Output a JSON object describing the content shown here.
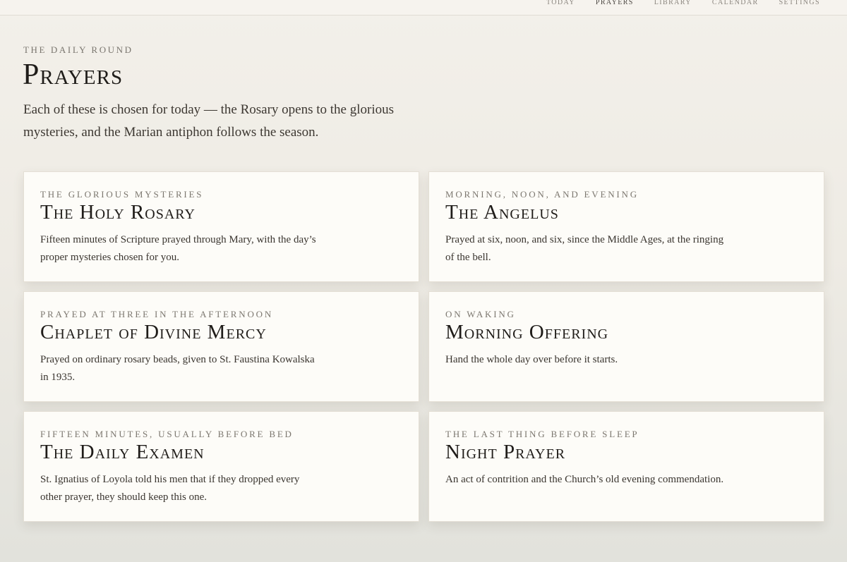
{
  "nav": {
    "items": [
      {
        "label": "Today"
      },
      {
        "label": "Prayers",
        "active": true
      },
      {
        "label": "Library"
      },
      {
        "label": "Calendar"
      },
      {
        "label": "Settings"
      }
    ]
  },
  "header": {
    "eyebrow": "The Daily Round",
    "title": "Prayers",
    "intro": "Each of these is chosen for today — the Rosary opens to the glorious mysteries, and the Marian antiphon follows the season."
  },
  "cards": [
    {
      "eyebrow": "The Glorious Mysteries",
      "title": "The Holy Rosary",
      "description": "Fifteen minutes of Scripture prayed through Mary, with the day’s proper mysteries chosen for you."
    },
    {
      "eyebrow": "Morning, Noon, and Evening",
      "title": "The Angelus",
      "description": "Prayed at six, noon, and six, since the Middle Ages, at the ringing of the bell."
    },
    {
      "eyebrow": "Prayed at Three in the Afternoon",
      "title": "Chaplet of Divine Mercy",
      "description": "Prayed on ordinary rosary beads, given to St. Faustina Kowalska in 1935."
    },
    {
      "eyebrow": "On Waking",
      "title": "Morning Offering",
      "description": "Hand the whole day over before it starts."
    },
    {
      "eyebrow": "Fifteen Minutes, Usually Before Bed",
      "title": "The Daily Examen",
      "description": "St. Ignatius of Loyola told his men that if they dropped every other prayer, they should keep this one."
    },
    {
      "eyebrow": "The Last Thing Before Sleep",
      "title": "Night Prayer",
      "description": "An act of contrition and the Church’s old evening commendation."
    }
  ]
}
